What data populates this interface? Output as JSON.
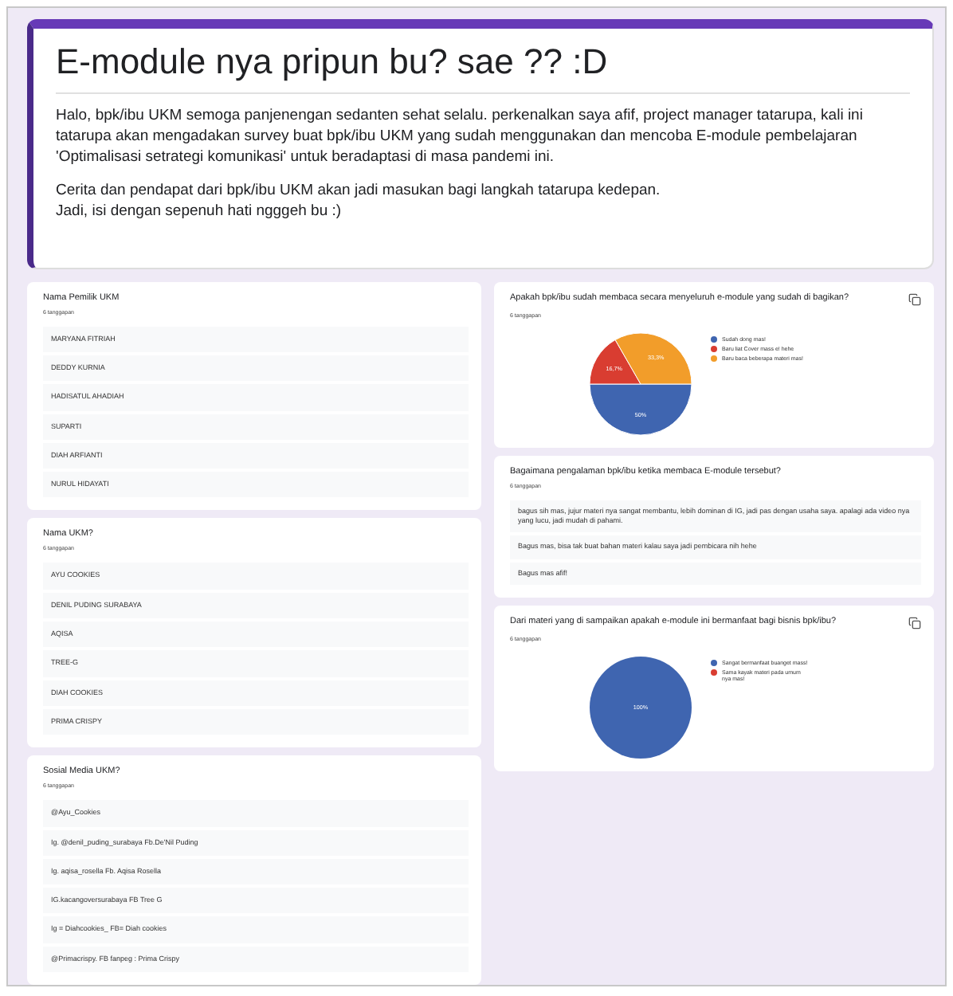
{
  "header": {
    "title": "E-module nya pripun bu? sae ?? :D",
    "paragraphs": [
      "Halo, bpk/ibu UKM semoga panjenengan sedanten sehat selalu. perkenalkan saya afif, project manager tatarupa, kali ini tatarupa akan mengadakan survey buat bpk/ibu UKM yang sudah menggunakan dan mencoba E-module pembelajaran 'Optimalisasi setrategi komunikasi' untuk beradaptasi di masa pandemi ini.",
      "Cerita dan pendapat dari bpk/ibu UKM akan jadi masukan bagi langkah tatarupa kedepan.\nJadi, isi dengan sepenuh hati ngggeh bu :)"
    ]
  },
  "left_cards": [
    {
      "title": "Nama Pemilik UKM",
      "count": "6 tanggapan",
      "answers": [
        "MARYANA FITRIAH",
        "DEDDY KURNIA",
        "HADISATUL AHADIAH",
        "SUPARTI",
        "DIAH ARFIANTI",
        "NURUL HIDAYATI"
      ]
    },
    {
      "title": "Nama UKM?",
      "count": "6 tanggapan",
      "answers": [
        "AYU COOKIES",
        "DENIL PUDING SURABAYA",
        "AQISA",
        "TREE-G",
        "DIAH COOKIES",
        "PRIMA CRISPY"
      ]
    },
    {
      "title": "Sosial Media UKM?",
      "count": "6 tanggapan",
      "answers": [
        "@Ayu_Cookies",
        "Ig. @denil_puding_surabaya Fb.De'Nil Puding",
        "Ig. aqisa_rosella Fb. Aqisa Rosella",
        "IG.kacangoversurabaya FB Tree G",
        "Ig = Diahcookies_ FB= Diah cookies",
        "@Primacrispy. FB fanpeg : Prima Crispy"
      ]
    }
  ],
  "right_cards": [
    {
      "kind": "pie",
      "title": "Apakah bpk/ibu sudah membaca secara menyeluruh e-module yang sudah di bagikan?",
      "count": "6 tanggapan",
      "chart_data": {
        "type": "pie",
        "values": [
          50,
          16.7,
          33.3
        ],
        "value_labels": [
          "50%",
          "16,7%",
          "33,3%"
        ]
      },
      "options": [
        {
          "label": "Sudah dong mas!",
          "color": "#3f65b0"
        },
        {
          "label": "Baru liat Cover mass e! hehe",
          "color": "#d93d31"
        },
        {
          "label": "Baru baca beberapa materi mas!",
          "color": "#f29d2a"
        }
      ]
    },
    {
      "kind": "text",
      "title": "Bagaimana pengalaman bpk/ibu ketika membaca E-module tersebut?",
      "count": "6 tanggapan",
      "answers": [
        "bagus sih mas, jujur materi nya sangat membantu, lebih dominan di IG, jadi pas dengan usaha saya. apalagi ada video nya yang lucu, jadi mudah di pahami.",
        "Bagus mas, bisa tak buat bahan materi kalau saya jadi pembicara nih hehe",
        "Bagus mas afif!"
      ]
    },
    {
      "kind": "pie",
      "title": "Dari materi yang di sampaikan apakah e-module ini bermanfaat bagi bisnis bpk/ibu?",
      "count": "6 tanggapan",
      "chart_data": {
        "type": "pie",
        "values": [
          100,
          0
        ],
        "value_labels": [
          "100%",
          null
        ]
      },
      "options": [
        {
          "label": "Sangat bermanfaat buanget mass!",
          "color": "#3f65b0"
        },
        {
          "label": "Sama kayak materi pada umum nya mas!",
          "color": "#d93d31"
        }
      ]
    }
  ]
}
